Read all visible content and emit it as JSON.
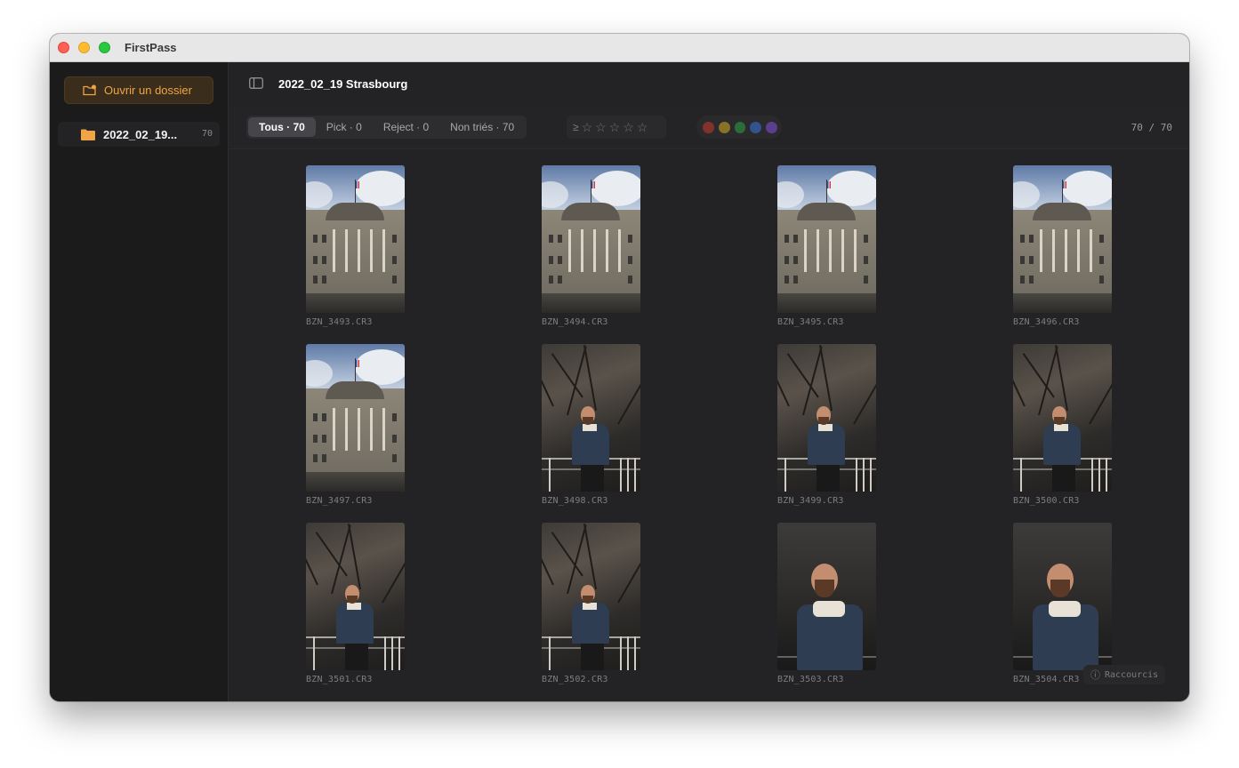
{
  "app": {
    "title": "FirstPass"
  },
  "sidebar": {
    "open_button": "Ouvrir un dossier",
    "folders": [
      {
        "name": "2022_02_19...",
        "count": "70"
      }
    ]
  },
  "header": {
    "title": "2022_02_19 Strasbourg"
  },
  "filters": {
    "tabs": [
      {
        "label": "Tous · 70",
        "active": true
      },
      {
        "label": "Pick · 0",
        "active": false
      },
      {
        "label": "Reject · 0",
        "active": false
      },
      {
        "label": "Non triés · 70",
        "active": false
      }
    ],
    "rating_prefix": "≥",
    "stars": [
      "☆",
      "☆",
      "☆",
      "☆",
      "☆"
    ],
    "color_labels": [
      "#c0392b",
      "#c9a227",
      "#2e9a45",
      "#3b6fd0",
      "#7a4fd0"
    ],
    "count": "70 / 70"
  },
  "photos": [
    {
      "name": "BZN_3493.CR3",
      "kind": "building"
    },
    {
      "name": "BZN_3494.CR3",
      "kind": "building"
    },
    {
      "name": "BZN_3495.CR3",
      "kind": "building"
    },
    {
      "name": "BZN_3496.CR3",
      "kind": "building"
    },
    {
      "name": "BZN_3497.CR3",
      "kind": "building"
    },
    {
      "name": "BZN_3498.CR3",
      "kind": "portrait"
    },
    {
      "name": "BZN_3499.CR3",
      "kind": "portrait"
    },
    {
      "name": "BZN_3500.CR3",
      "kind": "portrait"
    },
    {
      "name": "BZN_3501.CR3",
      "kind": "portrait"
    },
    {
      "name": "BZN_3502.CR3",
      "kind": "portrait"
    },
    {
      "name": "BZN_3503.CR3",
      "kind": "closeup"
    },
    {
      "name": "BZN_3504.CR3",
      "kind": "closeup"
    }
  ],
  "shortcuts": {
    "icon": "ⓘ",
    "label": "Raccourcis"
  }
}
